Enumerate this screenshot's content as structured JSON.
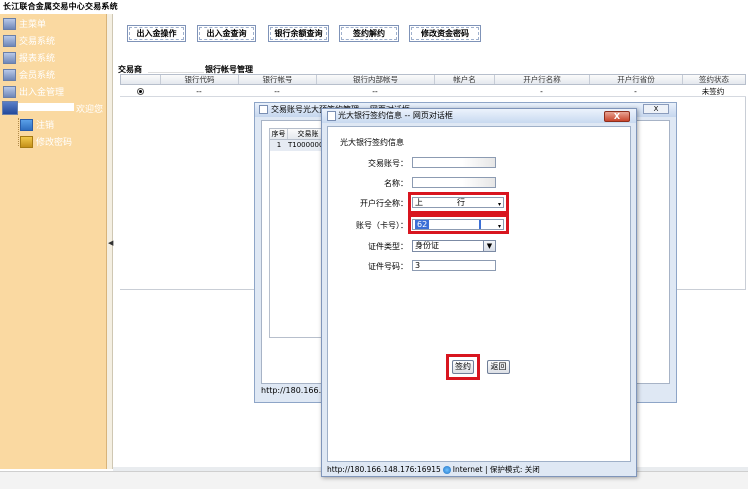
{
  "app": {
    "title": "长江联合金属交易中心交易系统"
  },
  "sidebar": {
    "items": [
      {
        "label": "主菜单"
      },
      {
        "label": "交易系统"
      },
      {
        "label": "报表系统"
      },
      {
        "label": "会员系统"
      },
      {
        "label": "出入金管理"
      },
      {
        "label": "欢迎您"
      },
      {
        "label": "注销"
      },
      {
        "label": "修改密码"
      }
    ]
  },
  "toolbar": {
    "buttons": [
      "出入金操作",
      "出入金查询",
      "银行余额查询",
      "签约解约",
      "修改资金密码"
    ]
  },
  "main": {
    "section_prefix": "交易商",
    "section_title": "银行帐号管理",
    "table": {
      "headers": [
        "",
        "银行代码",
        "银行帐号",
        "银行内部帐号",
        "帐户名",
        "开户行名称",
        "开户行省份",
        "签约状态"
      ],
      "rows": [
        [
          "",
          "--",
          "--",
          "--",
          "",
          "-",
          "-",
          "未签约"
        ]
      ]
    }
  },
  "dialog_back": {
    "title": "交易账号光大预签约管理 -- 网页对话框",
    "close": "X",
    "table_headers": [
      "序号",
      "交易账"
    ],
    "table_row": [
      "1",
      "T100000000"
    ],
    "status": "http://180.166.148"
  },
  "dialog_front": {
    "title": "光大银行签约信息 -- 网页对话框",
    "close": "X",
    "heading": "光大银行签约信息",
    "fields": {
      "trade_account": {
        "label": "交易账号：",
        "value": ""
      },
      "name": {
        "label": "名称：",
        "value": ""
      },
      "bank_full_name": {
        "label": "开户行全称：",
        "value": "上",
        "value2": "行"
      },
      "account_no": {
        "label": "账号（卡号）：",
        "value": "62"
      },
      "id_type": {
        "label": "证件类型：",
        "value": "身份证"
      },
      "id_number": {
        "label": "证件号码：",
        "value": "3"
      }
    },
    "sign_button": "签约",
    "back_button": "返回",
    "status": {
      "url": "http://180.166.148.176:16915",
      "zone": "Internet | 保护模式: 关闭"
    }
  },
  "colors": {
    "sidebar_bg": "#fad9a1",
    "highlight_red": "#d8151f",
    "selection_blue": "#3b6fd6"
  }
}
